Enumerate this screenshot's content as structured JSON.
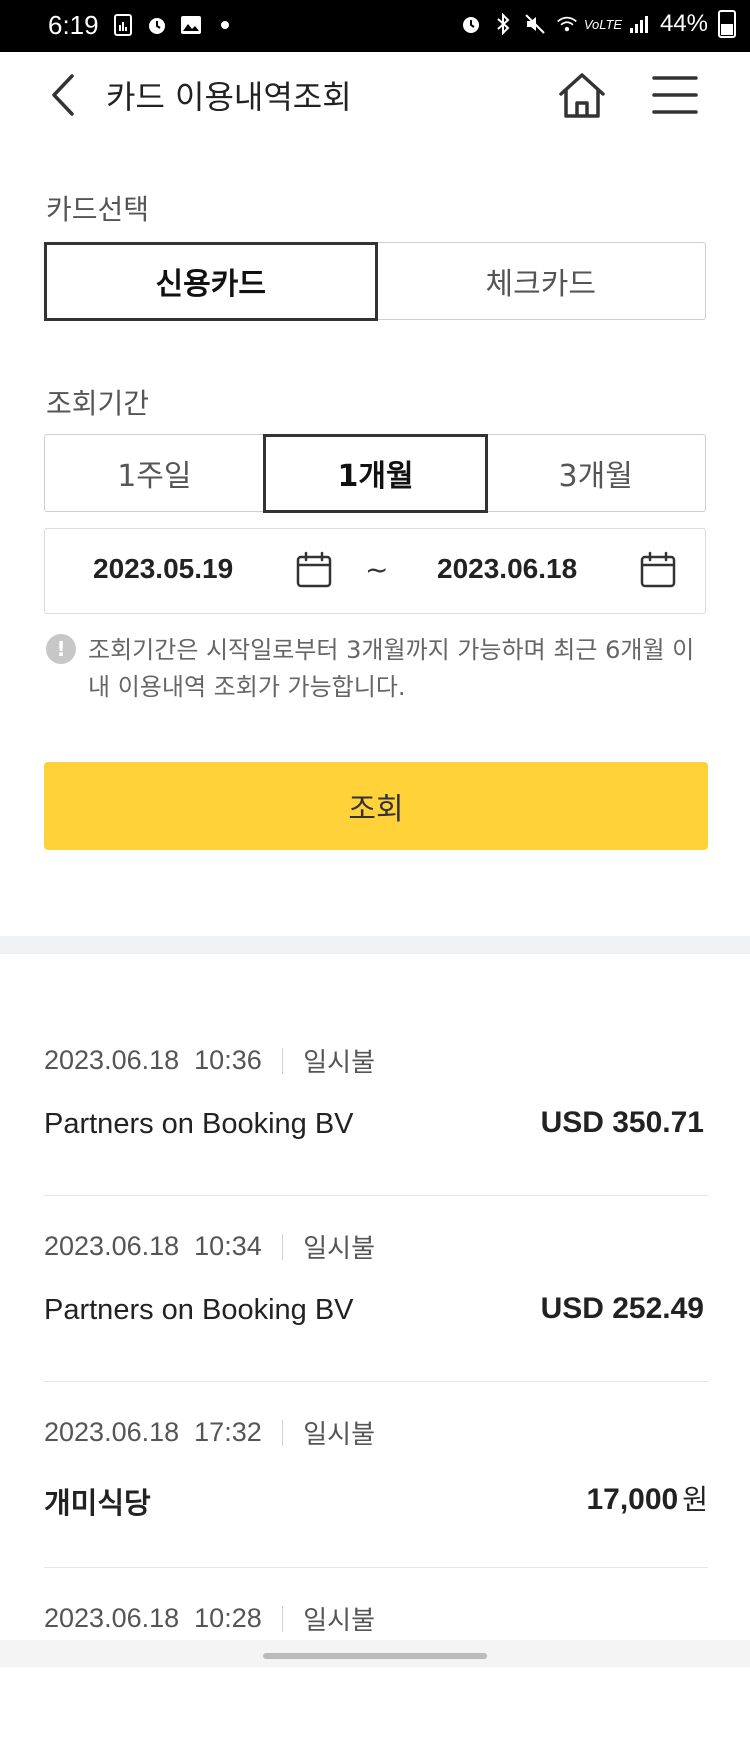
{
  "status": {
    "time": "6:19",
    "battery": "44%"
  },
  "header": {
    "title": "카드 이용내역조회"
  },
  "card_select": {
    "label": "카드선택",
    "options": [
      "신용카드",
      "체크카드"
    ],
    "selected": "신용카드"
  },
  "period": {
    "label": "조회기간",
    "options": [
      "1주일",
      "1개월",
      "3개월"
    ],
    "selected": "1개월"
  },
  "date_range": {
    "from": "2023.05.19",
    "separator": "~",
    "to": "2023.06.18"
  },
  "notice": "조회기간은 시작일로부터 3개월까지 가능하며 최근 6개월 이내 이용내역 조회가 가능합니다.",
  "query_button": "조회",
  "transactions": [
    {
      "date": "2023.06.18",
      "time": "10:36",
      "type": "일시불",
      "merchant": "Partners on Booking BV",
      "amount": "USD 350.71",
      "unit": ""
    },
    {
      "date": "2023.06.18",
      "time": "10:34",
      "type": "일시불",
      "merchant": "Partners on Booking BV",
      "amount": "USD 252.49",
      "unit": ""
    },
    {
      "date": "2023.06.18",
      "time": "17:32",
      "type": "일시불",
      "merchant": "개미식당",
      "amount": "17,000",
      "unit": "원"
    },
    {
      "date": "2023.06.18",
      "time": "10:28",
      "type": "일시불",
      "merchant": "",
      "amount": "",
      "unit": ""
    }
  ]
}
